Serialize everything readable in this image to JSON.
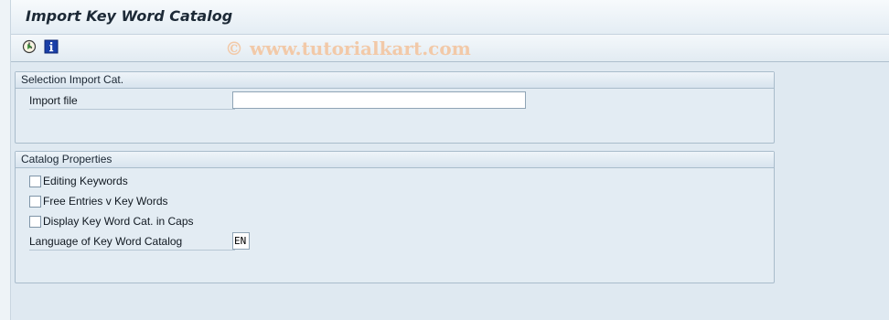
{
  "window": {
    "title": "Import Key Word Catalog"
  },
  "toolbar": {
    "execute_icon": "execute-clock-icon",
    "info_icon": "info-icon",
    "watermark": "© www.tutorialkart.com"
  },
  "selection_group": {
    "header": "Selection Import Cat.",
    "import_file_label": "Import file",
    "import_file_value": ""
  },
  "catalog_group": {
    "header": "Catalog Properties",
    "checkboxes": [
      {
        "label": "Editing Keywords",
        "checked": false
      },
      {
        "label": "Free Entries v Key Words",
        "checked": false
      },
      {
        "label": "Display Key Word Cat. in Caps",
        "checked": false
      }
    ],
    "language_label": "Language of Key Word Catalog",
    "language_value": "EN"
  },
  "colors": {
    "background": "#dfe9f1",
    "group_border": "#a9bccb",
    "watermark": "#f2c9a8"
  }
}
